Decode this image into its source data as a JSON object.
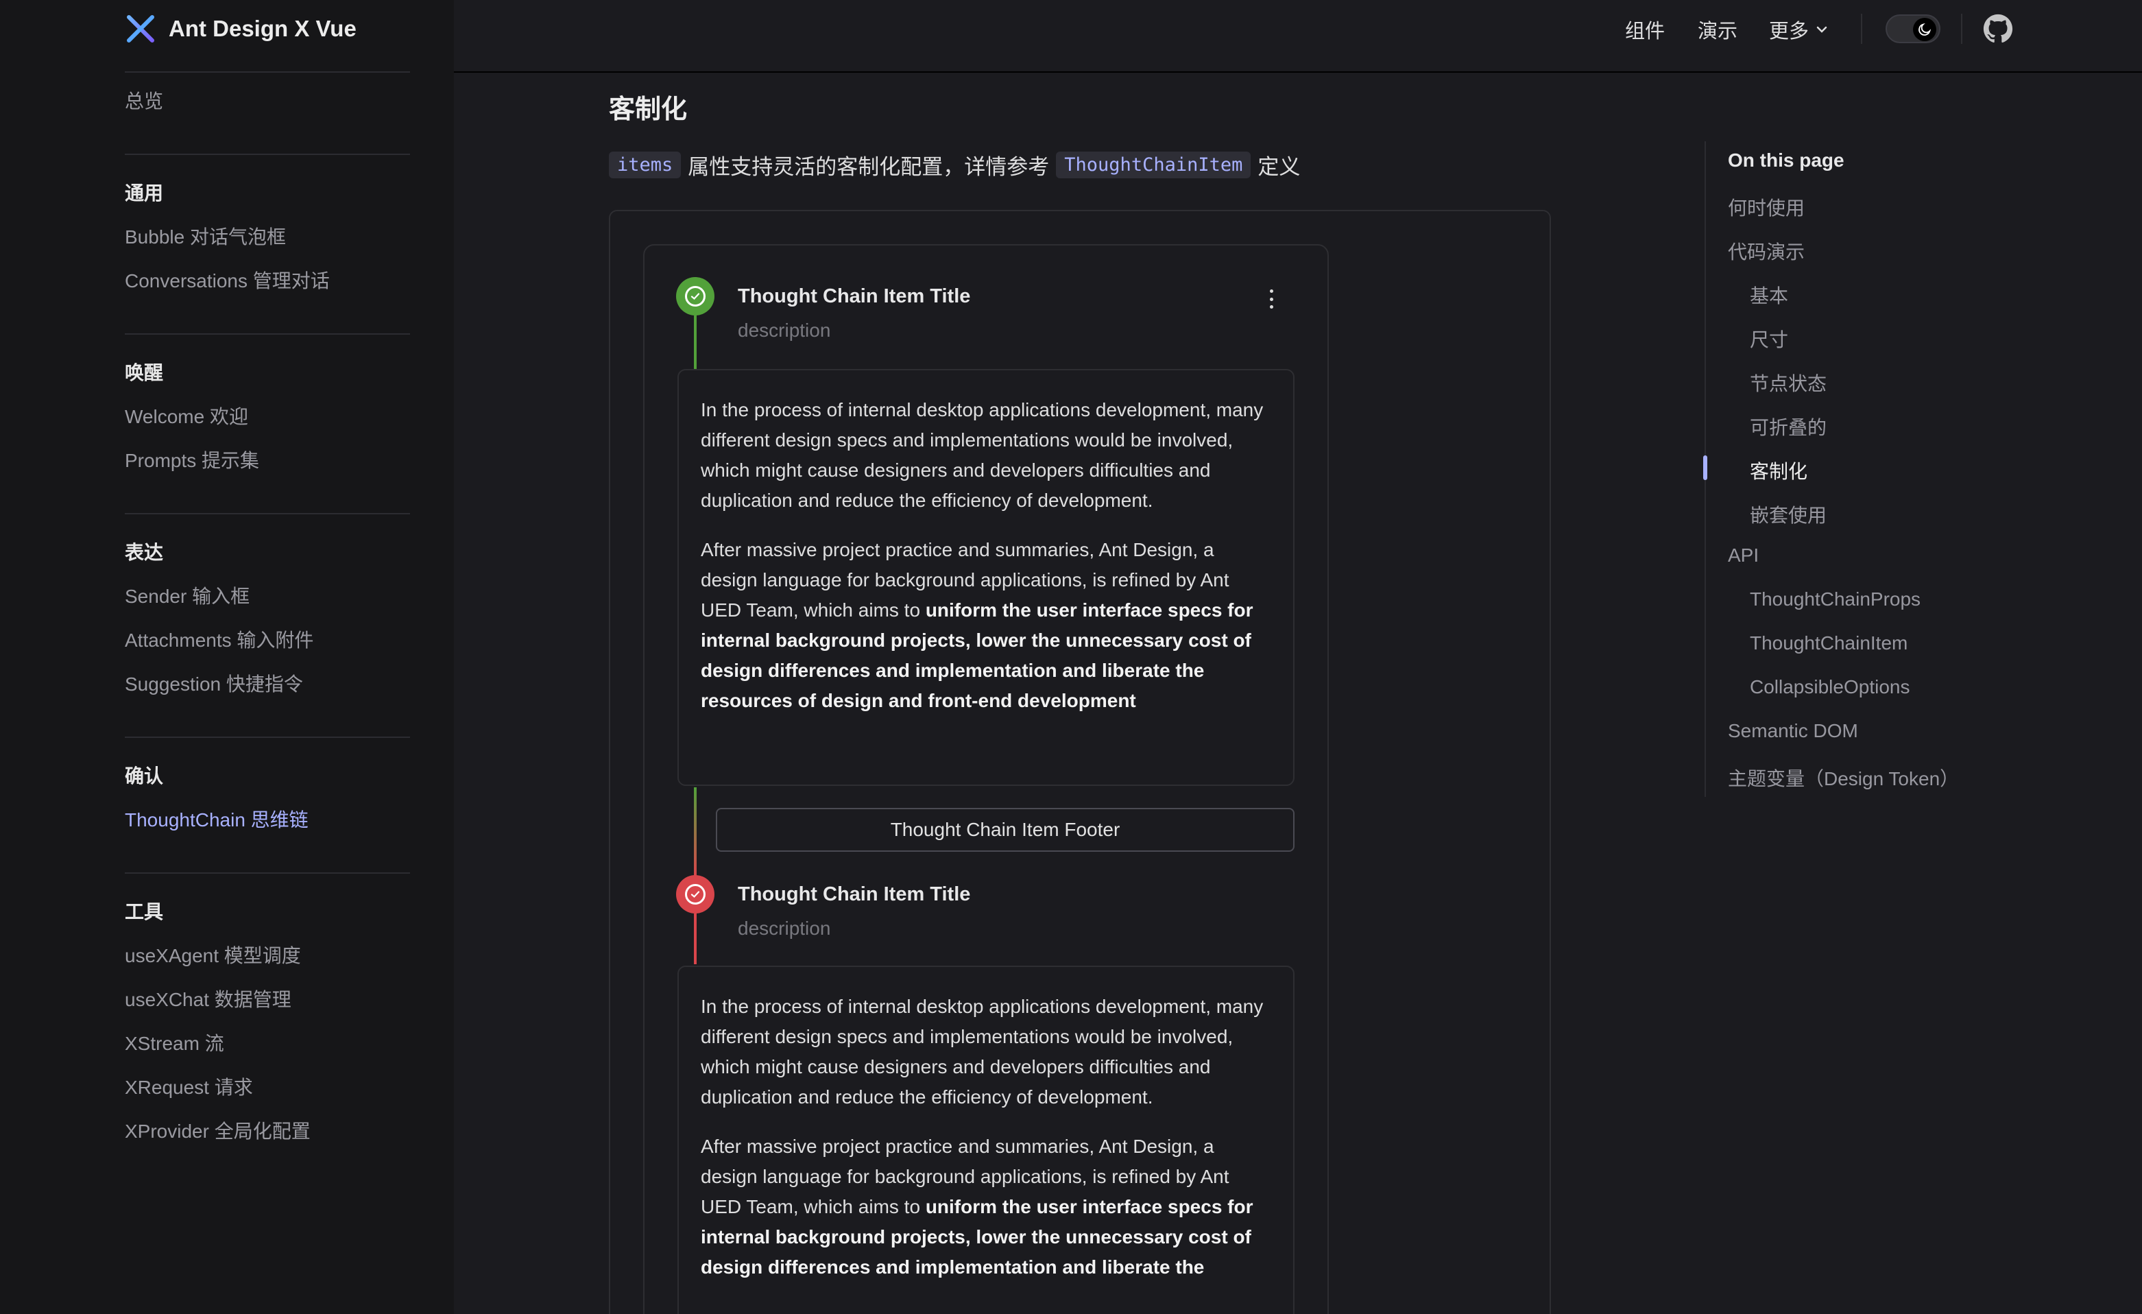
{
  "app": {
    "title": "Ant Design X Vue"
  },
  "sidebar": {
    "overview": "总览",
    "groups": [
      {
        "title": "通用",
        "items": [
          "Bubble 对话气泡框",
          "Conversations 管理对话"
        ]
      },
      {
        "title": "唤醒",
        "items": [
          "Welcome 欢迎",
          "Prompts 提示集"
        ]
      },
      {
        "title": "表达",
        "items": [
          "Sender 输入框",
          "Attachments 输入附件",
          "Suggestion 快捷指令"
        ]
      },
      {
        "title": "确认",
        "items": [
          "ThoughtChain 思维链"
        ]
      },
      {
        "title": "工具",
        "items": [
          "useXAgent 模型调度",
          "useXChat 数据管理",
          "XStream 流",
          "XRequest 请求",
          "XProvider 全局化配置"
        ]
      }
    ],
    "active_item": "ThoughtChain 思维链"
  },
  "topnav": {
    "components": "组件",
    "demos": "演示",
    "more": "更多"
  },
  "main": {
    "title": "客制化",
    "intro_code_1": "items",
    "intro_text": "属性支持灵活的客制化配置，详情参考",
    "intro_code_2": "ThoughtChainItem",
    "intro_suffix": "定义"
  },
  "thought_chain": {
    "items": [
      {
        "title": "Thought Chain Item Title",
        "description": "description",
        "status_color": "#52a13a",
        "p1": "In the process of internal desktop applications development, many different design specs and implementations would be involved, which might cause designers and developers difficulties and duplication and reduce the efficiency of development.",
        "p2_plain": "After massive project practice and summaries, Ant Design, a design language for background applications, is refined by Ant UED Team, which aims to ",
        "p2_bold": "uniform the user interface specs for internal background projects, lower the unnecessary cost of design differences and implementation and liberate the resources of design and front-end development",
        "footer": "Thought Chain Item Footer"
      },
      {
        "title": "Thought Chain Item Title",
        "description": "description",
        "status_color": "#d9454b",
        "p1": "In the process of internal desktop applications development, many different design specs and implementations would be involved, which might cause designers and developers difficulties and duplication and reduce the efficiency of development.",
        "p2_plain": "After massive project practice and summaries, Ant Design, a design language for background applications, is refined by Ant UED Team, which aims to ",
        "p2_bold": "uniform the user interface specs for internal background projects, lower the unnecessary cost of design differences and implementation and liberate the"
      }
    ]
  },
  "toc": {
    "title": "On this page",
    "items": [
      {
        "label": "何时使用",
        "level": 1
      },
      {
        "label": "代码演示",
        "level": 1
      },
      {
        "label": "基本",
        "level": 2
      },
      {
        "label": "尺寸",
        "level": 2
      },
      {
        "label": "节点状态",
        "level": 2
      },
      {
        "label": "可折叠的",
        "level": 2
      },
      {
        "label": "客制化",
        "level": 2,
        "active": true
      },
      {
        "label": "嵌套使用",
        "level": 2
      },
      {
        "label": "API",
        "level": 1
      },
      {
        "label": "ThoughtChainProps",
        "level": 2
      },
      {
        "label": "ThoughtChainItem",
        "level": 2
      },
      {
        "label": "CollapsibleOptions",
        "level": 2
      },
      {
        "label": "Semantic DOM",
        "level": 1
      },
      {
        "label": "主题变量（Design Token）",
        "level": 1
      }
    ]
  },
  "colors": {
    "accent": "#a8b1ff",
    "success": "#52a13a",
    "error": "#d9454b",
    "background": "#1b1b1f",
    "sidebar": "#161618"
  }
}
